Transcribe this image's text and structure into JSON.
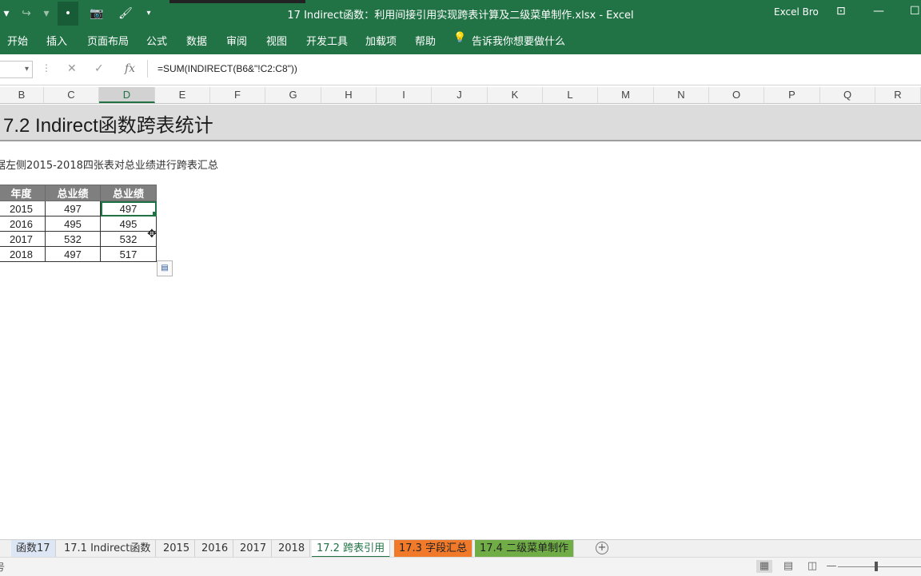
{
  "window": {
    "title": "17 Indirect函数：利用间接引用实现跨表计算及二级菜单制作.xlsx  -  Excel",
    "user": "Excel Bro",
    "min": "—",
    "restore": "☐",
    "ribbon_display": "⊡"
  },
  "qat": {
    "undo_arrow": "▾",
    "redo": "↪",
    "redo_arrow": "▾",
    "dot": "•",
    "camera": "📷",
    "brush": "🖌",
    "customize": "▾"
  },
  "ribbon": {
    "tabs": [
      "开始",
      "插入",
      "页面布局",
      "公式",
      "数据",
      "审阅",
      "视图",
      "开发工具",
      "加载项",
      "帮助"
    ],
    "tell_me": "告诉我你想要做什么",
    "tell_me_icon": "💡"
  },
  "formula_bar": {
    "namebox_arrow": "▾",
    "separator": "⋮",
    "cancel": "✕",
    "enter": "✓",
    "fx": "fx",
    "formula": "=SUM(INDIRECT(B6&\"!C2:C8\"))"
  },
  "columns": [
    "B",
    "C",
    "D",
    "E",
    "F",
    "G",
    "H",
    "I",
    "J",
    "K",
    "L",
    "M",
    "N",
    "O",
    "P",
    "Q",
    "R"
  ],
  "selected_column": "D",
  "sheet": {
    "title": "7.2 Indirect函数跨表统计",
    "description": "据左侧2015-2018四张表对总业绩进行跨表汇总",
    "headers": [
      "年度",
      "总业绩",
      "总业绩"
    ],
    "rows": [
      [
        "2015",
        "497",
        "497"
      ],
      [
        "2016",
        "495",
        "495"
      ],
      [
        "2017",
        "532",
        "532"
      ],
      [
        "2018",
        "497",
        "517"
      ]
    ]
  },
  "cursor": "✥",
  "paste_options": "▤",
  "sheet_tabs": [
    "函数17",
    "17.1 Indirect函数",
    "2015",
    "2016",
    "2017",
    "2018",
    "17.2 跨表引用",
    "17.3 字段汇总",
    "17.4 二级菜单制作"
  ],
  "active_sheet": "17.2 跨表引用",
  "tab_colors": {
    "函数17": "#dce6f4",
    "17.3 字段汇总": "#f07a2a",
    "17.4 二级菜单制作": "#70ad47"
  },
  "add_sheet": "+",
  "status": {
    "left_glyph": "号",
    "view_normal": "▦",
    "view_layout": "▤",
    "view_break": "◫",
    "zoom_minus": "—",
    "zoom_plus": "+"
  },
  "accent": "#217346"
}
